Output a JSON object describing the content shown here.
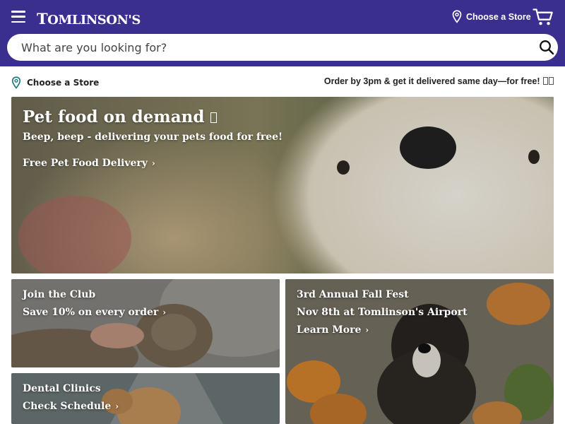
{
  "header": {
    "logo_prefix": "T",
    "logo_rest": "OMLINSON'S",
    "store_label": "Choose a Store",
    "menu_icon": "hamburger-menu-icon",
    "cart_icon": "shopping-cart-icon",
    "location_icon": "map-pin-icon",
    "background_color": "#3a2e8f"
  },
  "search": {
    "placeholder": "What are you looking for?",
    "value": "",
    "icon": "search-icon"
  },
  "subbar": {
    "store_label": "Choose a Store",
    "promo_text": "Order by 3pm & get it delivered same day—for free!"
  },
  "hero": {
    "title": "Pet food on demand",
    "subtitle": "Beep, beep - delivering your pets food for free!",
    "link": "Free Pet Food Delivery",
    "image": "golden retriever close-up"
  },
  "tiles": [
    {
      "line1": "Join the Club",
      "line2": "Save 10% on every order",
      "image": "tabby cat being petted"
    },
    {
      "line1": "3rd Annual Fall Fest",
      "line2": "Nov 8th at Tomlinson's Airport",
      "line3": "Learn More",
      "image": "black dog among pumpkins"
    },
    {
      "line1": "Dental Clinics",
      "line2": "Check Schedule",
      "image": "dog on a path"
    }
  ],
  "chevron": "›"
}
